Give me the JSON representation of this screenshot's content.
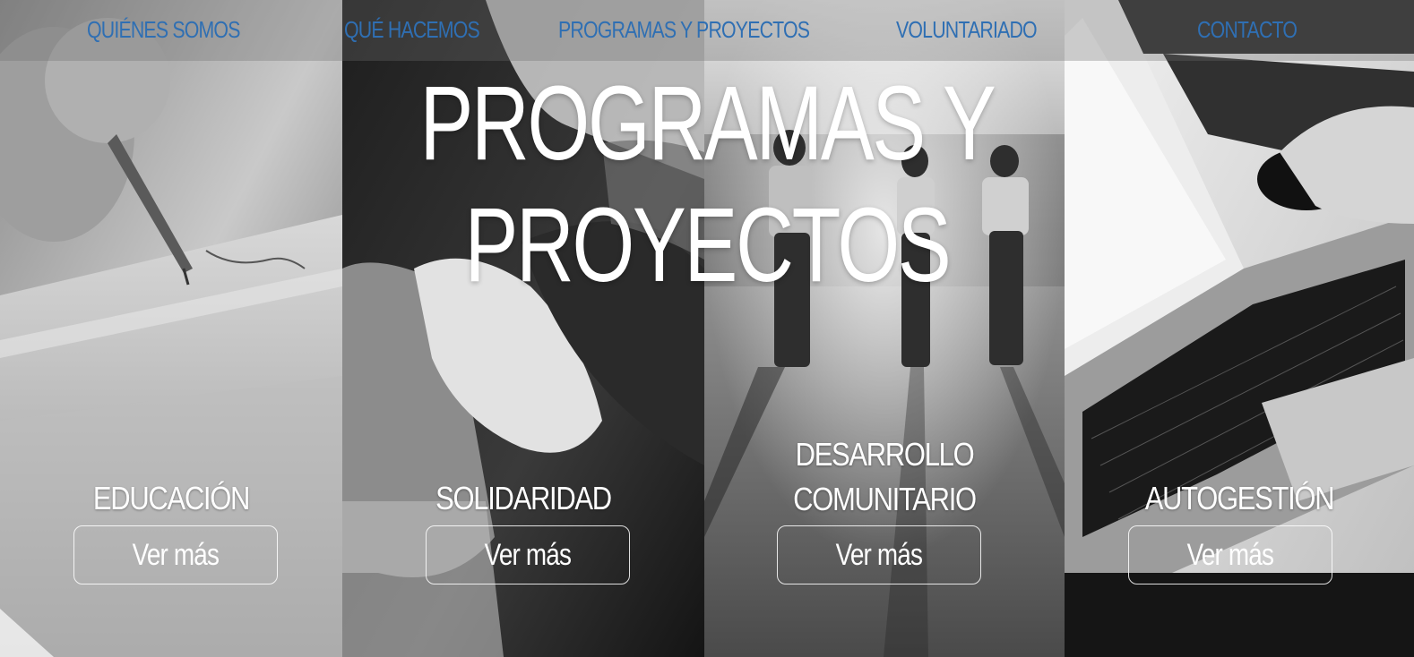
{
  "nav": {
    "items": [
      {
        "label": "QUIÉNES SOMOS"
      },
      {
        "label": "QUÉ HACEMOS"
      },
      {
        "label": "PROGRAMAS Y PROYECTOS"
      },
      {
        "label": "VOLUNTARIADO"
      },
      {
        "label": "CONTACTO"
      }
    ],
    "link_color": "#2f6fb3"
  },
  "hero": {
    "title": "PROGRAMAS Y PROYECTOS"
  },
  "programs": [
    {
      "title": "EDUCACIÓN",
      "button": "Ver más",
      "image": "writing-hand-photo"
    },
    {
      "title": "SOLIDARIDAD",
      "button": "Ver más",
      "image": "holding-hands-photo"
    },
    {
      "title_line1": "DESARROLLO",
      "title_line2": "COMUNITARIO",
      "button": "Ver más",
      "image": "people-walking-field-photo"
    },
    {
      "title": "AUTOGESTIÓN",
      "button": "Ver más",
      "image": "laptop-keyboard-photo"
    }
  ]
}
